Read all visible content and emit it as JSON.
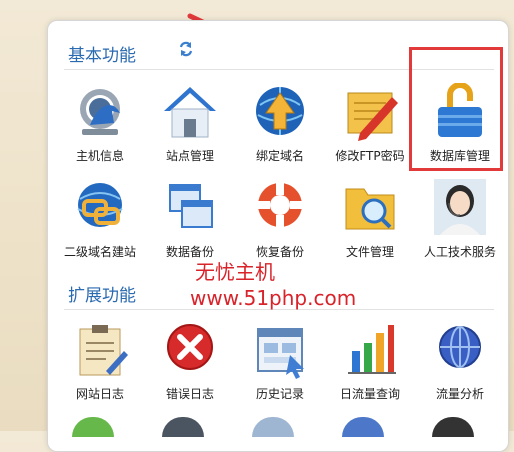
{
  "sections": {
    "basic_title": "基本功能",
    "ext_title": "扩展功能"
  },
  "basic": [
    {
      "label": "主机信息",
      "icon": "host-info-icon"
    },
    {
      "label": "站点管理",
      "icon": "site-management-icon"
    },
    {
      "label": "绑定域名",
      "icon": "bind-domain-icon"
    },
    {
      "label": "修改FTP密码",
      "icon": "change-ftp-password-icon"
    },
    {
      "label": "数据库管理",
      "icon": "database-management-icon"
    },
    {
      "label": "二级域名建站",
      "icon": "subdomain-site-icon"
    },
    {
      "label": "数据备份",
      "icon": "data-backup-icon"
    },
    {
      "label": "恢复备份",
      "icon": "restore-backup-icon"
    },
    {
      "label": "文件管理",
      "icon": "file-management-icon"
    },
    {
      "label": "人工技术服务",
      "icon": "tech-support-icon"
    }
  ],
  "extended": [
    {
      "label": "网站日志",
      "icon": "website-log-icon"
    },
    {
      "label": "错误日志",
      "icon": "error-log-icon"
    },
    {
      "label": "历史记录",
      "icon": "history-record-icon"
    },
    {
      "label": "日流量查询",
      "icon": "daily-traffic-icon"
    },
    {
      "label": "流量分析",
      "icon": "traffic-analysis-icon"
    }
  ],
  "watermark": {
    "line1": "无忧主机",
    "line2": "www.51php.com"
  },
  "colors": {
    "section_title": "#2a6ab0",
    "highlight": "#e23a3a",
    "watermark": "#d8232a"
  }
}
